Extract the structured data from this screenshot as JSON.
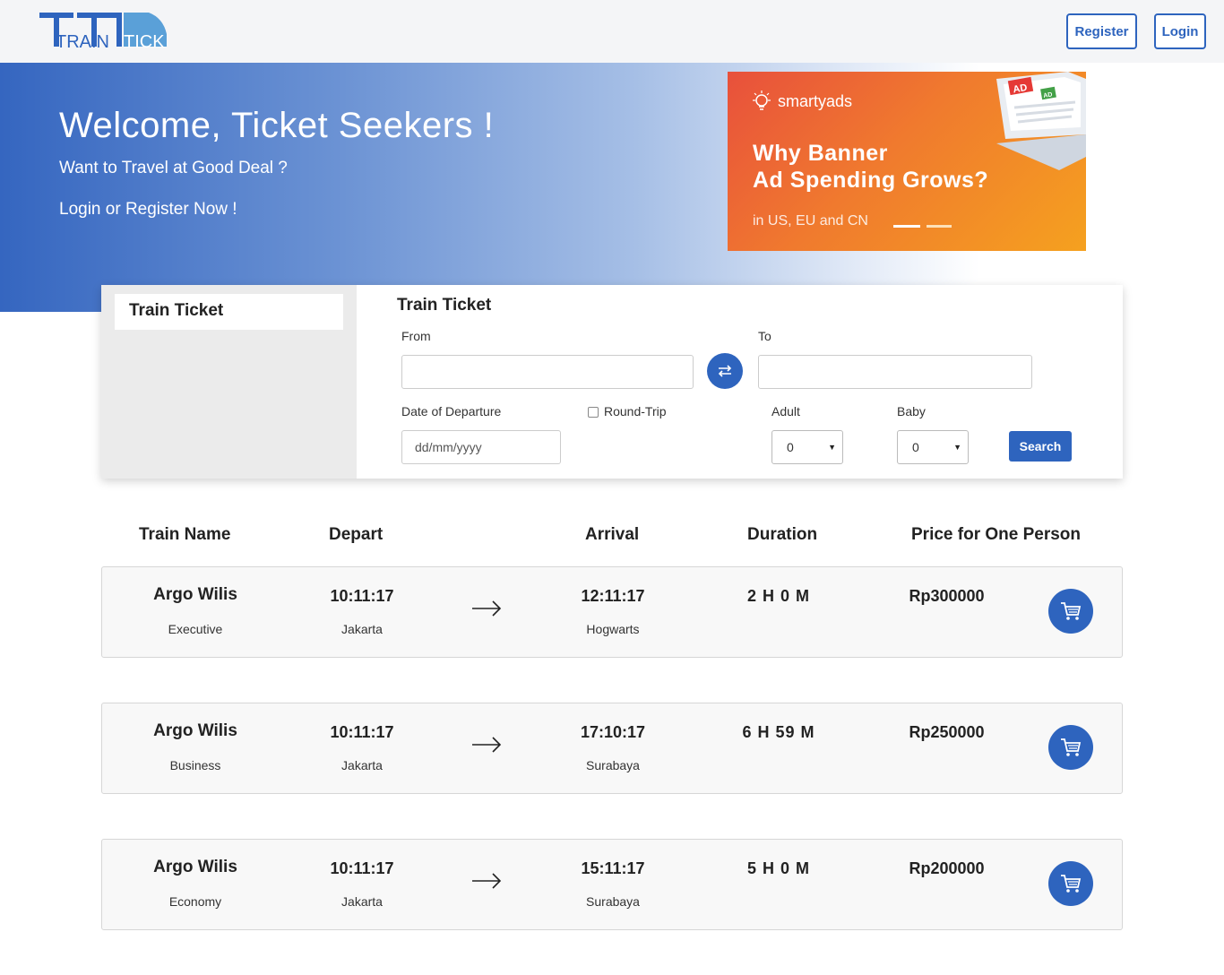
{
  "nav": {
    "logo_text_main": "TRAIN",
    "logo_text_sub": "TICK",
    "register_label": "Register",
    "login_label": "Login"
  },
  "hero": {
    "title": "Welcome, Ticket Seekers !",
    "subtitle": "Want to Travel at Good Deal ?",
    "cta_text": "Login or Register Now !"
  },
  "ad": {
    "brand": "smartyads",
    "headline_line1": "Why Banner",
    "headline_line2": "Ad Spending Grows?",
    "footer": "in US, EU and CN",
    "badge1": "AD",
    "badge2": "AD"
  },
  "search": {
    "side_tab": "Train Ticket",
    "form_title": "Train Ticket",
    "from_label": "From",
    "from_value": "",
    "to_label": "To",
    "to_value": "",
    "date_label": "Date of Departure",
    "date_placeholder": "dd/mm/yyyy",
    "roundtrip_label": "Round-Trip",
    "adult_label": "Adult",
    "adult_value": "0",
    "baby_label": "Baby",
    "baby_value": "0",
    "search_label": "Search",
    "swap_icon": "swap-arrows-icon"
  },
  "results": {
    "headers": {
      "train_name": "Train Name",
      "depart": "Depart",
      "arrival": "Arrival",
      "duration": "Duration",
      "price": "Price for One Person"
    },
    "rows": [
      {
        "name": "Argo Wilis",
        "class": "Executive",
        "depart_time": "10:11:17",
        "depart_city": "Jakarta",
        "arrival_time": "12:11:17",
        "arrival_city": "Hogwarts",
        "duration": "2 H 0 M",
        "price": "Rp300000"
      },
      {
        "name": "Argo Wilis",
        "class": "Business",
        "depart_time": "10:11:17",
        "depart_city": "Jakarta",
        "arrival_time": "17:10:17",
        "arrival_city": "Surabaya",
        "duration": "6 H 59 M",
        "price": "Rp250000"
      },
      {
        "name": "Argo Wilis",
        "class": "Economy",
        "depart_time": "10:11:17",
        "depart_city": "Jakarta",
        "arrival_time": "15:11:17",
        "arrival_city": "Surabaya",
        "duration": "5 H 0 M",
        "price": "Rp200000"
      }
    ]
  },
  "colors": {
    "primary": "#2e64be",
    "hero_start": "#3566c0",
    "ad_orange": "#f07a2e"
  }
}
